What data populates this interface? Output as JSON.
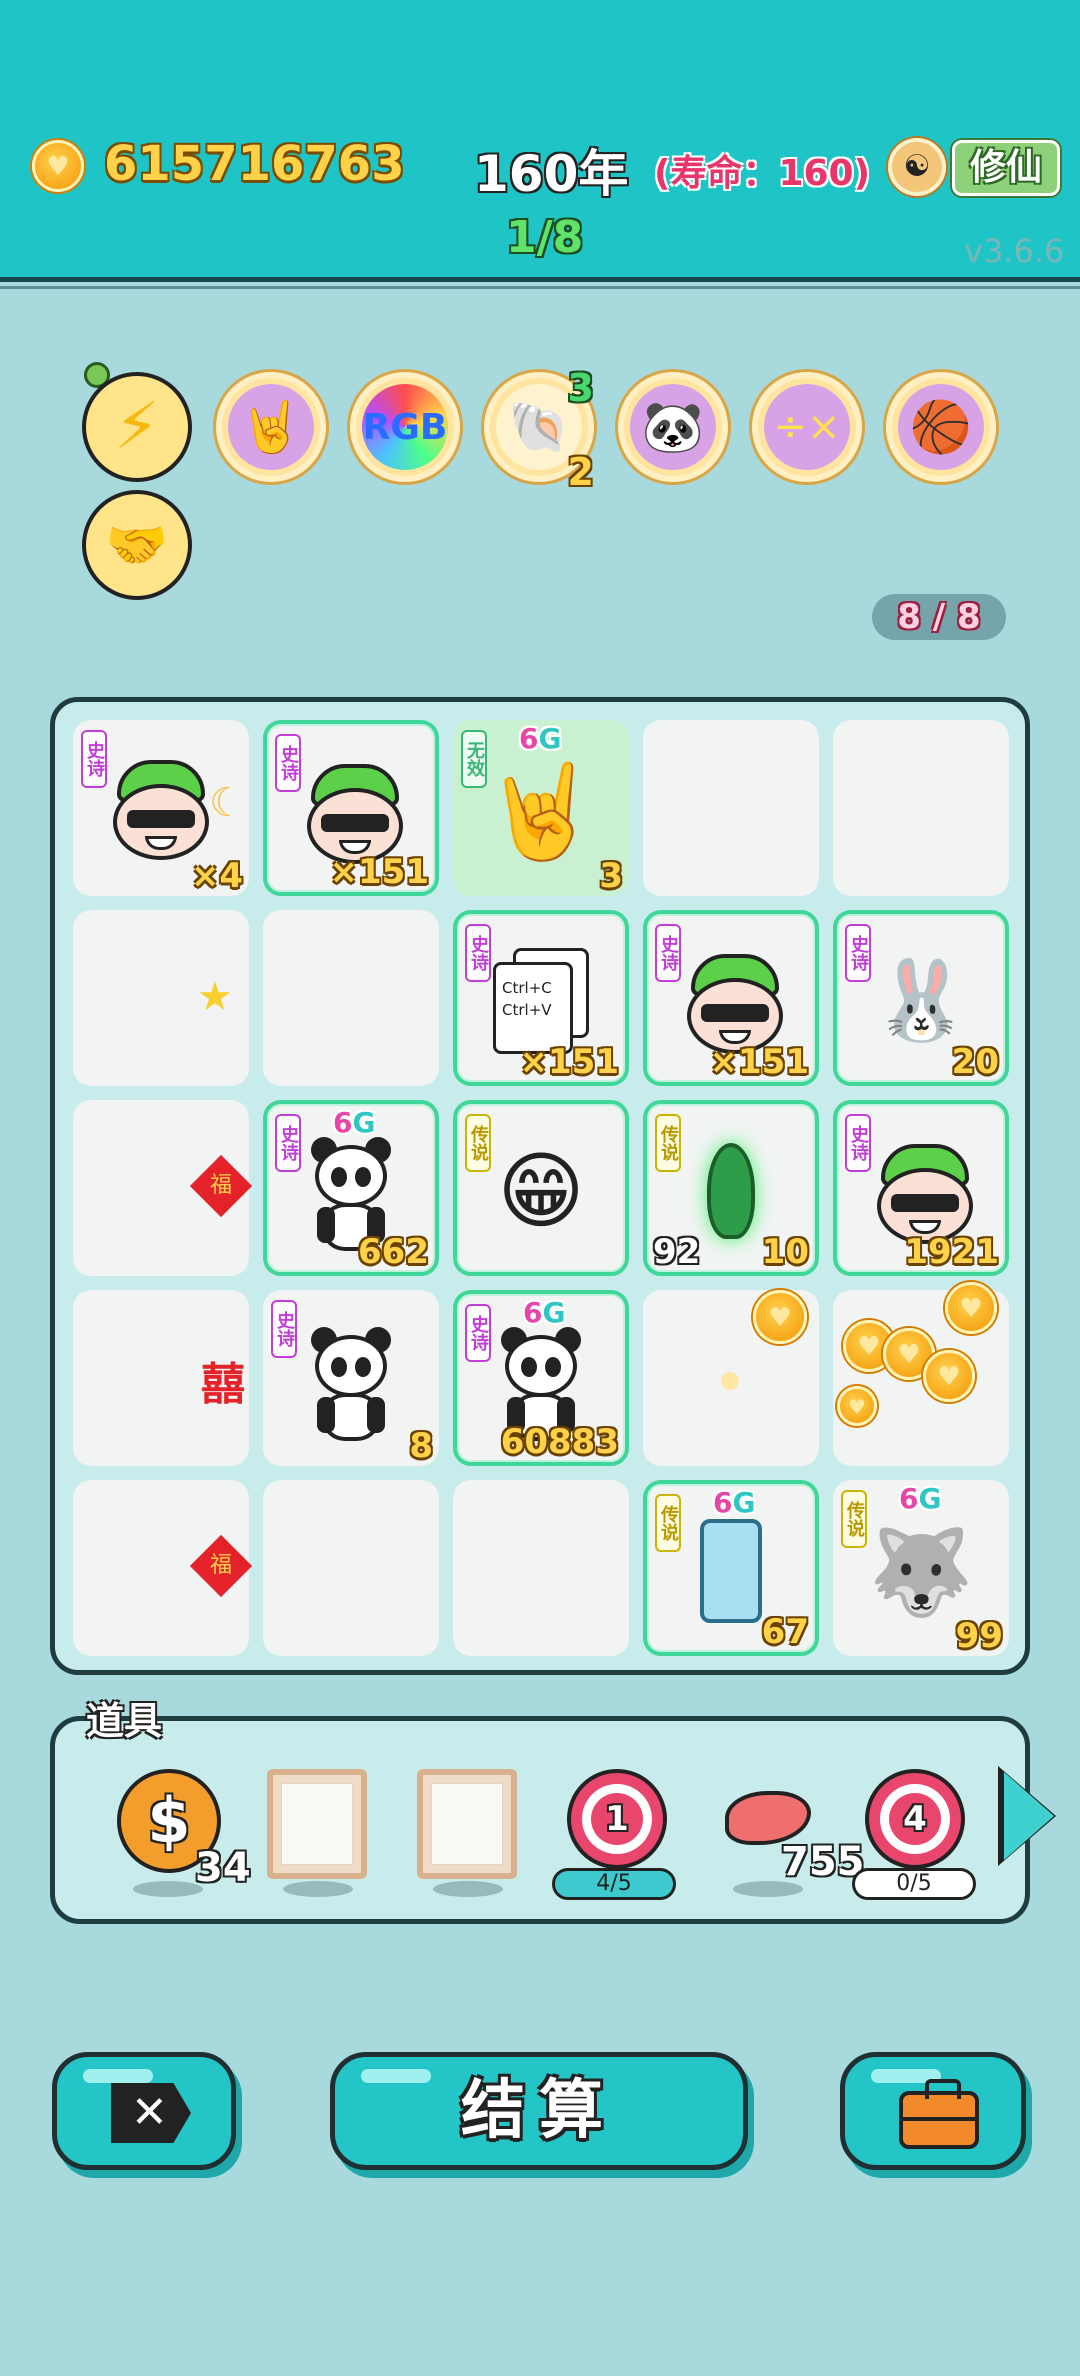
{
  "header": {
    "gold": "615716763",
    "year": "160年",
    "lifespan": "(寿命：160)",
    "round": "1/8",
    "cultivate_label": "修仙",
    "version": "v3.6.6"
  },
  "relics": [
    {
      "icon": "lightning-icon",
      "glyph": "⚡"
    },
    {
      "icon": "rock-hand-icon",
      "glyph": "🤘"
    },
    {
      "icon": "rgb-icon",
      "glyph": "RGB"
    },
    {
      "icon": "shell-icon",
      "glyph": "🐚",
      "top": "3",
      "bottom": "2"
    },
    {
      "icon": "panda-icon",
      "glyph": "🐼"
    },
    {
      "icon": "math-face-icon",
      "glyph": "÷"
    },
    {
      "icon": "basketballs-icon",
      "glyph": "🏀"
    },
    {
      "icon": "handshake-icon",
      "glyph": "🤝"
    }
  ],
  "capacity": "8 / 8",
  "board": {
    "cells": [
      {
        "tag": "史诗",
        "count": "×4"
      },
      {
        "tag": "史诗",
        "count": "×151"
      },
      {
        "tag": "无效",
        "g": "6",
        "count": "3"
      },
      {},
      {},
      {},
      {},
      {
        "tag": "史诗",
        "text": "Ctrl+C\nCtrl+V",
        "count": "×151"
      },
      {
        "tag": "史诗",
        "count": "×151"
      },
      {
        "tag": "史诗",
        "count": "20"
      },
      {
        "small": "福"
      },
      {
        "tag": "史诗",
        "g": "6",
        "count": "662"
      },
      {
        "tag": "传说",
        "count": ""
      },
      {
        "tag": "传说",
        "left": "92",
        "count": "10"
      },
      {
        "tag": "史诗",
        "count": "1921"
      },
      {
        "small": "囍"
      },
      {
        "tag": "史诗",
        "count": "8"
      },
      {
        "tag": "史诗",
        "g": "6",
        "count": "60883"
      },
      {},
      {},
      {
        "small": "福"
      },
      {},
      {},
      {
        "tag": "传说",
        "g": "6",
        "count": "67"
      },
      {
        "tag": "传说",
        "g": "6",
        "count": "99"
      }
    ],
    "g_letter": "G"
  },
  "items": {
    "title": "道具",
    "coins_count": "34",
    "target1": "1",
    "target1_charge": "4/5",
    "meat_count": "755",
    "target2": "4",
    "target2_charge": "0/5"
  },
  "buttons": {
    "close": "✕",
    "settle": "结算"
  }
}
